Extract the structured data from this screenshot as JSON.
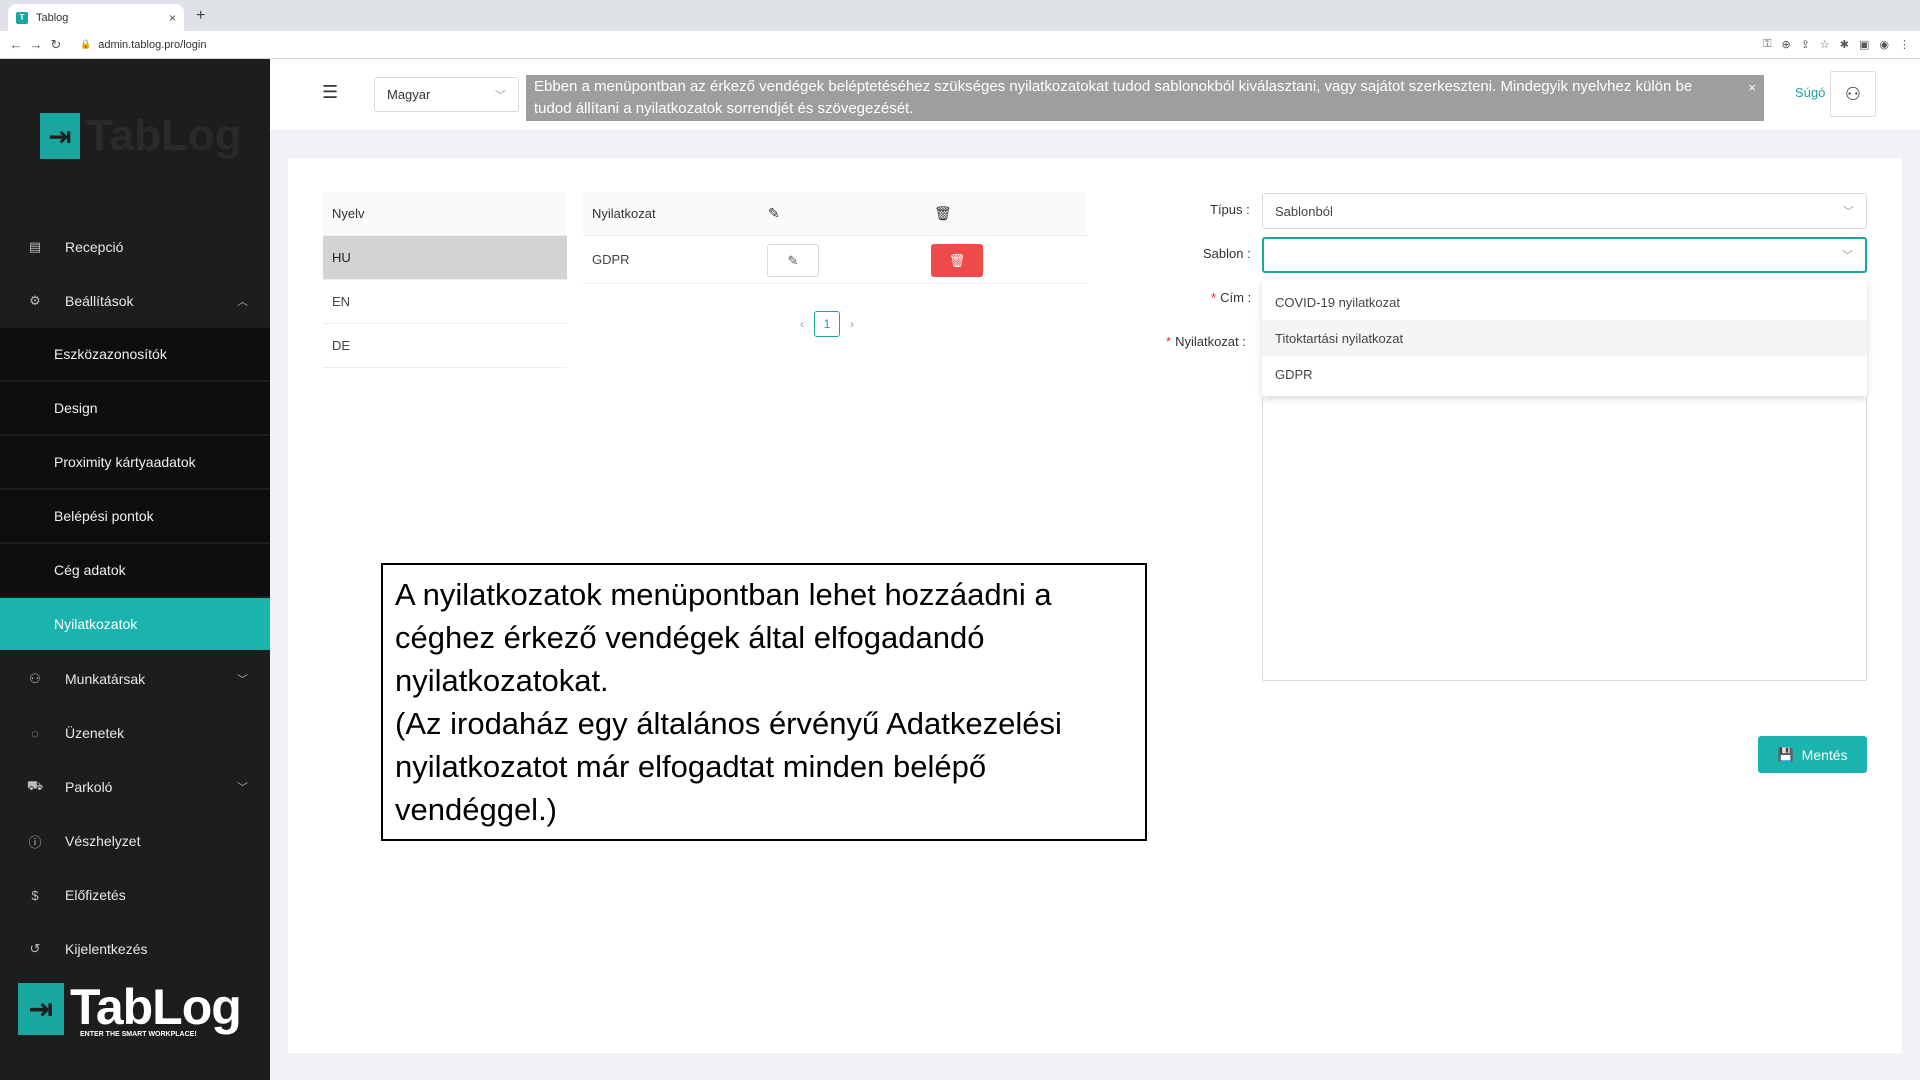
{
  "browser": {
    "tab_title": "Tablog",
    "tab_close": "×",
    "new_tab": "+",
    "url": "admin.tablog.pro/login"
  },
  "sidebar": {
    "logo_text": "TabLog",
    "items": [
      {
        "label": "Recepció",
        "icon": "reception-icon"
      },
      {
        "label": "Beállítások",
        "icon": "gear-icon",
        "expanded": true
      },
      {
        "label": "Munkatársak",
        "icon": "user-icon"
      },
      {
        "label": "Üzenetek",
        "icon": "message-icon"
      },
      {
        "label": "Parkoló",
        "icon": "car-icon"
      },
      {
        "label": "Vészhelyzet",
        "icon": "alert-icon"
      },
      {
        "label": "Előfizetés",
        "icon": "dollar-icon"
      },
      {
        "label": "Kijelentkezés",
        "icon": "logout-icon"
      }
    ],
    "sub_items": [
      "Eszközazonosítók",
      "Design",
      "Proximity kártyaadatok",
      "Belépési pontok",
      "Cég adatok",
      "Nyilatkozatok"
    ],
    "active_sub": "Nyilatkozatok",
    "bottom_logo": {
      "word": "TabLog",
      "tagline": "ENTER THE SMART WORKPLACE!"
    }
  },
  "header": {
    "language": "Magyar",
    "banner": "Ebben a menüpontban az érkező vendégek beléptetéséhez szükséges nyilatkozatokat tudod sablonokból kiválasztani, vagy sajátot szerkeszteni. Mindegyik nyelvhez külön be tudod állítani a nyilatkozatok sorrendjét és szövegezését.",
    "banner_close": "×",
    "help": "Súgó"
  },
  "languages": {
    "header": "Nyelv",
    "rows": [
      "HU",
      "EN",
      "DE"
    ],
    "selected": "HU"
  },
  "declarations": {
    "header": "Nyilatkozat",
    "rows": [
      {
        "name": "GDPR"
      }
    ],
    "page": "1",
    "prev": "‹",
    "next": "›"
  },
  "form": {
    "type_label": "Típus :",
    "type_value": "Sablonból",
    "template_label": "Sablon :",
    "template_value": "",
    "title_label": "Cím :",
    "declaration_label": "Nyilatkozat :",
    "template_options": [
      "COVID-19 nyilatkozat",
      "Titoktartási nyilatkozat",
      "GDPR"
    ],
    "hovered_option": "Titoktartási nyilatkozat",
    "save": "Mentés"
  },
  "annotation": {
    "text": "A nyilatkozatok menüpontban lehet hozzáadni a céghez érkező vendégek által elfogadandó nyilatkozatokat.\n(Az irodaház egy általános érvényű Adatkezelési nyilatkozatot már elfogadtat minden belépő vendéggel.)"
  },
  "colors": {
    "accent": "#1bb3ad",
    "sidebar": "#1d1d1d",
    "danger": "#ef4a4a",
    "banner": "#9e9e9e"
  }
}
